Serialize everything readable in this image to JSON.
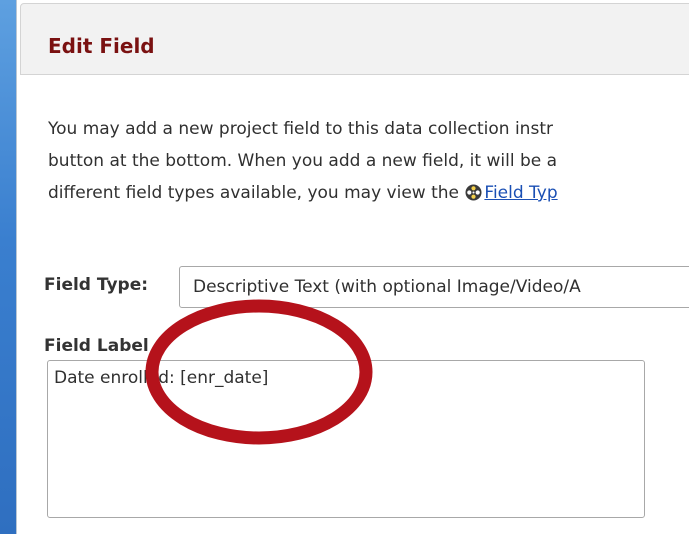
{
  "dialog": {
    "title": "Edit Field",
    "intro_lines": [
      "You may add a new project field to this data collection instr",
      "button at the bottom. When you add a new field, it will be a",
      "different field types available, you may view the "
    ],
    "field_types_link": "Field Typ"
  },
  "form": {
    "field_type_label": "Field Type:",
    "field_type_value": "Descriptive Text (with optional Image/Video/A",
    "field_label_heading": "Field Label",
    "field_label_value": "Date enrolled: [enr_date]"
  },
  "annotation": {
    "circle_color": "#b5121b"
  }
}
